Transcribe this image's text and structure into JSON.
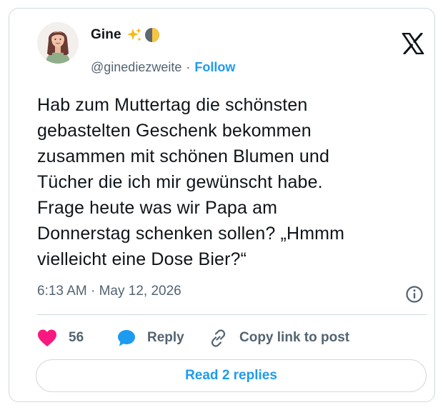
{
  "author": {
    "display_name": "Gine",
    "handle": "@ginediezweite",
    "separator": "·",
    "follow_label": "Follow"
  },
  "icons": {
    "name_emoji": [
      "sparkles-icon",
      "first-quarter-moon-icon"
    ],
    "brand": "x-logo-icon",
    "info": "info-icon",
    "like": "heart-icon",
    "reply": "speech-bubble-icon",
    "copy": "link-icon"
  },
  "tweet": {
    "lines": [
      "Hab zum Muttertag die schönsten",
      "gebastelten Geschenk bekommen",
      "zusammen mit schönen Blumen und",
      "Tücher die ich mir gewünscht habe.",
      "Frage heute was wir Papa am",
      "Donnerstag schenken sollen? „Hmmm",
      "vielleicht eine Dose Bier?“"
    ],
    "timestamp": "6:13 AM · May 12, 2026"
  },
  "actions": {
    "like_count": "56",
    "reply_label": "Reply",
    "copy_label": "Copy link to post"
  },
  "footer": {
    "read_replies_label": "Read 2 replies"
  },
  "colors": {
    "accent": "#1d9bf0",
    "heart": "#f91880",
    "text": "#0f1419",
    "secondary_text": "#536471",
    "border": "#cfd9de"
  }
}
